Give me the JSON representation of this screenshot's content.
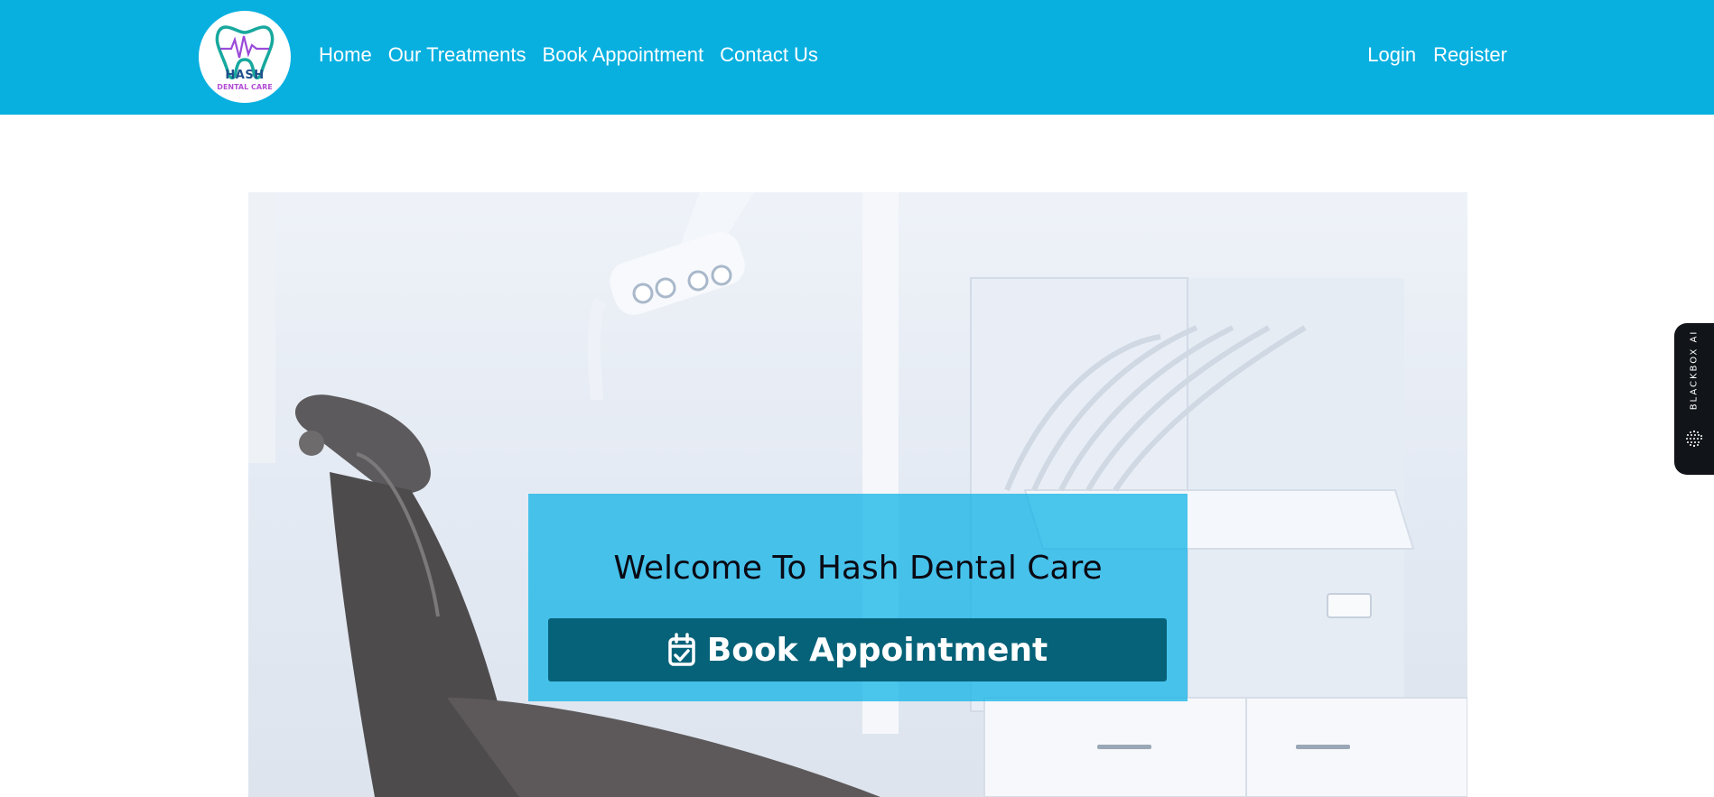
{
  "brand": {
    "logo_line1": "HASH",
    "logo_line2": "DENTAL CARE",
    "logo_icon": "tooth-heartbeat-icon"
  },
  "nav": {
    "left": [
      {
        "label": "Home"
      },
      {
        "label": "Our Treatments"
      },
      {
        "label": "Book Appointment"
      },
      {
        "label": "Contact Us"
      }
    ],
    "right": [
      {
        "label": "Login"
      },
      {
        "label": "Register"
      }
    ]
  },
  "hero": {
    "image": "dental-clinic-chair-photo",
    "title": "Welcome To Hash Dental Care",
    "cta_label": "Book Appointment",
    "cta_icon": "calendar-check-icon"
  },
  "widget": {
    "label": "BLACKBOX AI",
    "icon": "dotted-sphere-icon"
  },
  "colors": {
    "header": "#08b0e0",
    "overlay": "#08b2e6",
    "button": "#066278",
    "widget": "#111418"
  }
}
